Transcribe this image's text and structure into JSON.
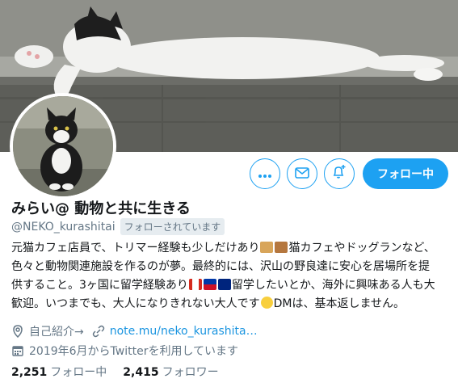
{
  "profile": {
    "display_name": "みらい@ 動物と共に生きる",
    "handle": "@NEKO_kurashitai",
    "follows_you": "フォローされています",
    "bio_lines": [
      "元猫カフェ店員で、トリマー経験も少しだけあり",
      "猫カフェやドッグランなど、",
      "色々と動物関連施設を作るのが夢。最終的には、沢山の野良達に安心を居場所を提",
      "供すること。3ヶ国に留学経験あり",
      "留学したいとか、海外に興味ある人も大",
      "歓迎。いつまでも、大人になりきれない大人です",
      "DMは、基本返しません。"
    ],
    "location": "自己紹介→",
    "url": "note.mu/neko_kurashita…",
    "joined": "2019年6月からTwitterを利用しています",
    "following_count": "2,251",
    "following_label": "フォロー中",
    "followers_count": "2,415",
    "followers_label": "フォロワー"
  },
  "actions": {
    "more_icon": "more-icon",
    "message_icon": "envelope-icon",
    "notify_icon": "bell-plus-icon",
    "follow_button": "フォロー中"
  },
  "colors": {
    "accent": "#1da1f2",
    "secondary_text": "#657786",
    "link": "#1b95e0"
  }
}
